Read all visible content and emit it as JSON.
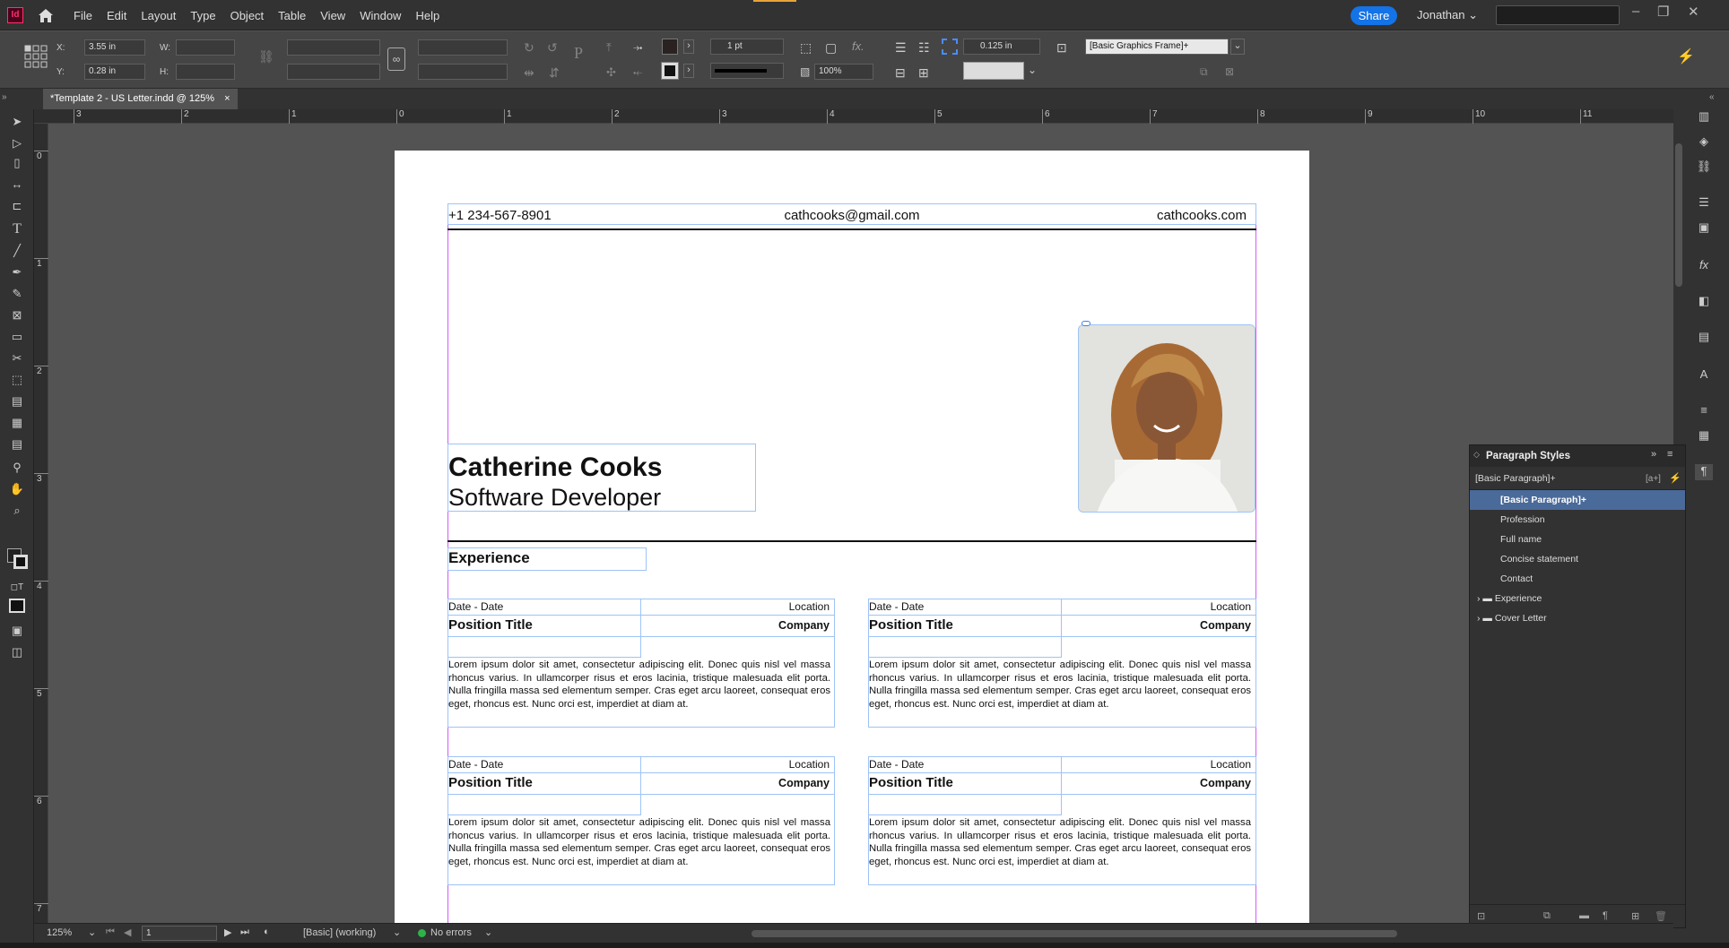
{
  "app": {
    "logo": "Id",
    "menu": [
      "File",
      "Edit",
      "Layout",
      "Type",
      "Object",
      "Table",
      "View",
      "Window",
      "Help"
    ],
    "share_label": "Share",
    "user": "Jonathan"
  },
  "control": {
    "x_label": "X:",
    "x_value": "3.55 in",
    "y_label": "Y:",
    "y_value": "0.28 in",
    "w_label": "W:",
    "h_label": "H:",
    "stroke_weight": "1 pt",
    "scale": "100%",
    "offset": "0.125 in",
    "object_style": "[Basic Graphics Frame]+"
  },
  "document": {
    "tab_title": "*Template 2 - US Letter.indd @ 125%",
    "close": "×"
  },
  "rulers": {
    "h_ticks": [
      "3",
      "2",
      "1",
      "0",
      "1",
      "2",
      "3",
      "4",
      "5",
      "6",
      "7",
      "8",
      "9",
      "10",
      "11"
    ],
    "v_ticks": [
      "0",
      "1",
      "2",
      "3",
      "4",
      "5",
      "6",
      "7"
    ]
  },
  "resume": {
    "phone": "+1 234-567-8901",
    "email": "cathcooks@gmail.com",
    "website": "cathcooks.com",
    "name": "Catherine Cooks",
    "profession": "Software Developer",
    "section_title": "Experience",
    "jobs": [
      {
        "date": "Date - Date",
        "location": "Location",
        "title": "Position Title",
        "company": "Company",
        "text": "Lorem ipsum dolor sit amet, consectetur adipiscing elit. Donec quis nisl vel massa rhoncus varius. In ullamcorper risus et eros lacinia, tristique malesuada elit porta. Nulla fringilla massa sed elementum semper. Cras eget arcu laoreet, consequat eros eget, rhoncus est. Nunc orci est, imperdiet at diam at."
      },
      {
        "date": "Date - Date",
        "location": "Location",
        "title": "Position Title",
        "company": "Company",
        "text": "Lorem ipsum dolor sit amet, consectetur adipiscing elit. Donec quis nisl vel massa rhoncus varius. In ullamcorper risus et eros lacinia, tristique malesuada elit porta. Nulla fringilla massa sed elementum semper. Cras eget arcu laoreet, consequat eros eget, rhoncus est. Nunc orci est, imperdiet at diam at."
      },
      {
        "date": "Date - Date",
        "location": "Location",
        "title": "Position Title",
        "company": "Company",
        "text": "Lorem ipsum dolor sit amet, consectetur adipiscing elit. Donec quis nisl vel massa rhoncus varius. In ullamcorper risus et eros lacinia, tristique malesuada elit porta. Nulla fringilla massa sed elementum semper. Cras eget arcu laoreet, consequat eros eget, rhoncus est. Nunc orci est, imperdiet at diam at."
      },
      {
        "date": "Date - Date",
        "location": "Location",
        "title": "Position Title",
        "company": "Company",
        "text": "Lorem ipsum dolor sit amet, consectetur adipiscing elit. Donec quis nisl vel massa rhoncus varius. In ullamcorper risus et eros lacinia, tristique malesuada elit porta. Nulla fringilla massa sed elementum semper. Cras eget arcu laoreet, consequat eros eget, rhoncus est. Nunc orci est, imperdiet at diam at."
      }
    ]
  },
  "paragraph_styles": {
    "title": "Paragraph Styles",
    "current": "[Basic Paragraph]+",
    "items": [
      "[Basic Paragraph]+",
      "Profession",
      "Full name",
      "Concise statement",
      "Contact"
    ],
    "groups": [
      "Experience",
      "Cover Letter"
    ]
  },
  "status": {
    "zoom": "125%",
    "page": "1",
    "style": "[Basic] (working)",
    "errors": "No errors"
  },
  "colors": {
    "accent": "#1473e6",
    "selection": "#4a6a99",
    "frame": "#9ec3f7",
    "margin": "#d35cf5"
  }
}
